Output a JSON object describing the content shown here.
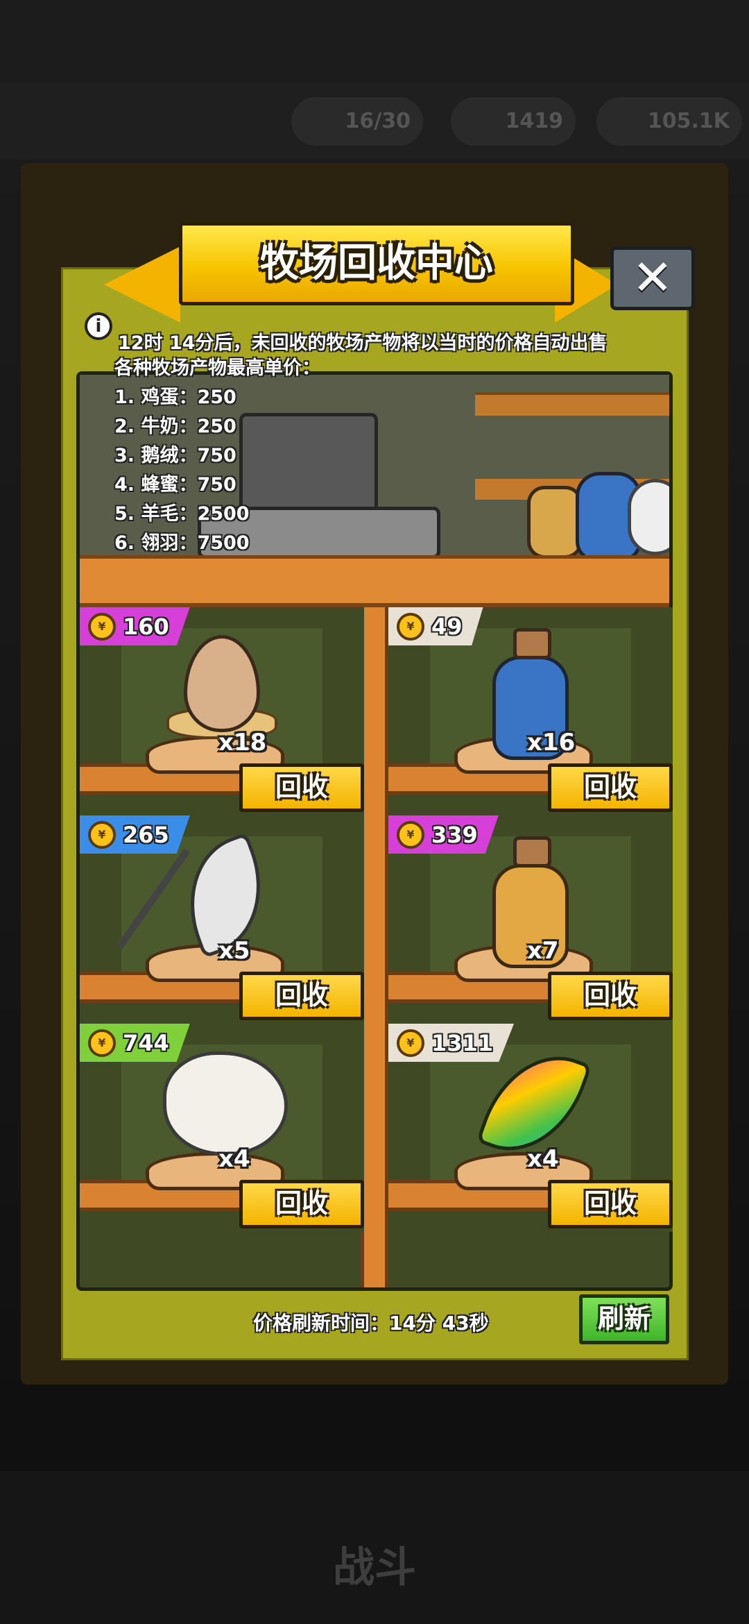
{
  "background": {
    "top_bar_values": [
      "16/30",
      "1419",
      "105.1K"
    ],
    "battle_label": "战斗"
  },
  "dialog": {
    "title": "牧场回收中心",
    "close_icon": "close-x",
    "notice": "12时 14分后，未回收的牧场产物将以当时的价格自动出售",
    "price_list_title": "各种牧场产物最高单价：",
    "price_list": [
      "1. 鸡蛋：250",
      "2. 牛奶：250",
      "3. 鹅绒：750",
      "4. 蜂蜜：750",
      "5. 羊毛：2500",
      "6. 翎羽：7500"
    ],
    "items": [
      {
        "item": "egg",
        "price": "160",
        "quantity": "x18",
        "button": "回收",
        "tag_color": "#d63fd8"
      },
      {
        "item": "milk",
        "price": "49",
        "quantity": "x16",
        "button": "回收",
        "tag_color": "#e8e2d6"
      },
      {
        "item": "down-feather",
        "price": "265",
        "quantity": "x5",
        "button": "回收",
        "tag_color": "#3b8ee8"
      },
      {
        "item": "honey",
        "price": "339",
        "quantity": "x7",
        "button": "回收",
        "tag_color": "#d63fd8"
      },
      {
        "item": "wool",
        "price": "744",
        "quantity": "x4",
        "button": "回收",
        "tag_color": "#7fd03a"
      },
      {
        "item": "peacock-feather",
        "price": "1311",
        "quantity": "x4",
        "button": "回收",
        "tag_color": "#e8e2d6"
      }
    ],
    "refresh_time": "价格刷新时间：14分 43秒",
    "refresh_button": "刷新"
  }
}
